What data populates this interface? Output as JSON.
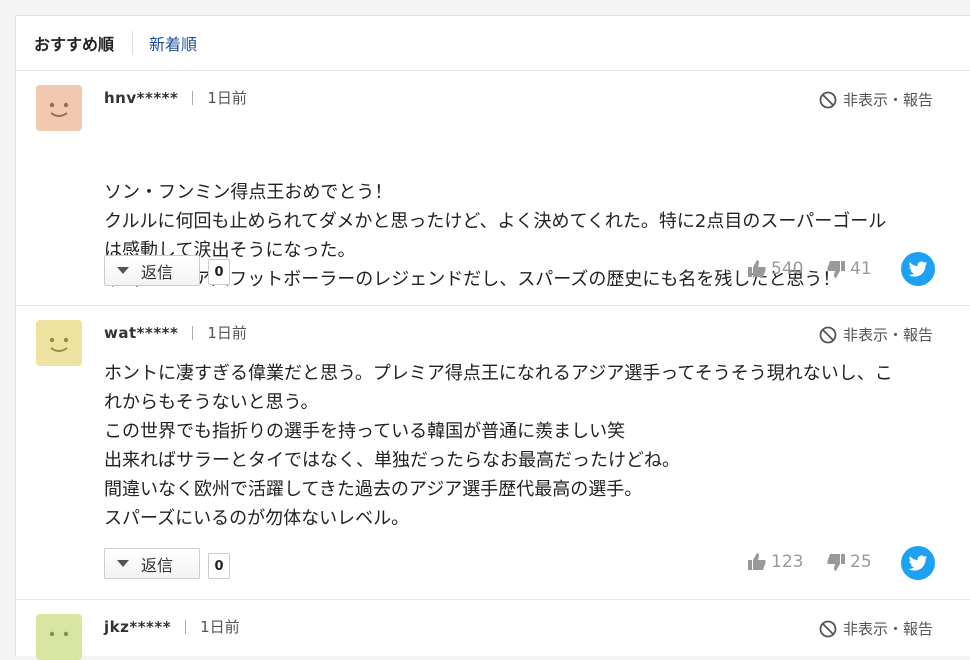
{
  "sort": {
    "recommended": "おすすめ順",
    "newest": "新着順"
  },
  "comments": [
    {
      "avatar_color": "#f0c9b0",
      "user": "hnv*****",
      "time": "1日前",
      "report": "非表示・報告",
      "lines": [
        "ソン・フンミン得点王おめでとう！",
        "クルルに何回も止められてダメかと思ったけど、よく決めてくれた。特に2点目のスーパーゴール",
        "は感動して涙出そうになった。",
        "本当にアジア人フットボーラーのレジェンドだし、スパーズの歴史にも名を残したと思う！"
      ],
      "reply_label": "返信",
      "reply_count": "0",
      "likes": "540",
      "dislikes": "41"
    },
    {
      "avatar_color": "#ede2a0",
      "user": "wat*****",
      "time": "1日前",
      "report": "非表示・報告",
      "lines": [
        "ホントに凄すぎる偉業だと思う。プレミア得点王になれるアジア選手ってそうそう現れないし、こ",
        "れからもそうないと思う。",
        "この世界でも指折りの選手を持っている韓国が普通に羨ましい笑",
        "出来ればサラーとタイではなく、単独だったらなお最高だったけどね。",
        "間違いなく欧州で活躍してきた過去のアジア選手歴代最高の選手。",
        "スパーズにいるのが勿体ないレベル。"
      ],
      "reply_label": "返信",
      "reply_count": "0",
      "likes": "123",
      "dislikes": "25"
    },
    {
      "avatar_color": "#d8e6a2",
      "user": "jkz*****",
      "time": "1日前",
      "report": "非表示・報告"
    }
  ]
}
